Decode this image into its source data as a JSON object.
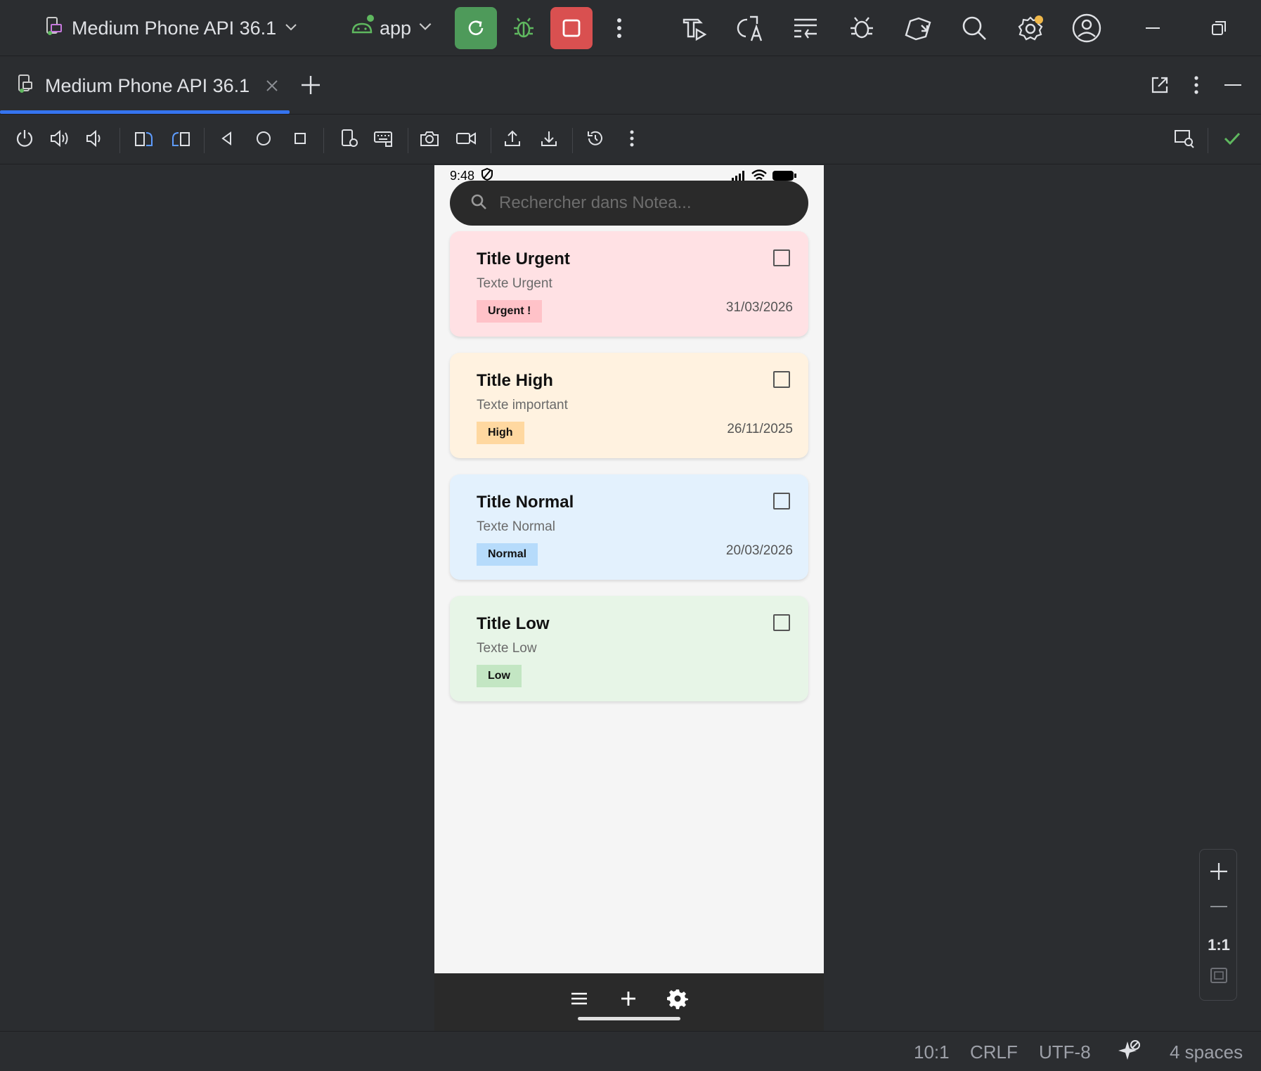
{
  "window": {
    "device_selector": "Medium Phone API 36.1",
    "app_selector": "app"
  },
  "tab": {
    "label": "Medium Phone API 36.1"
  },
  "phone": {
    "status_time": "9:48",
    "search_placeholder": "Rechercher dans Notea...",
    "notes": [
      {
        "title": "Title Urgent",
        "text": "Texte Urgent",
        "badge": "Urgent !",
        "date": "31/03/2026",
        "bg": "#ffe1e4",
        "badge_bg": "#ffc2c8"
      },
      {
        "title": "Title High",
        "text": "Texte important",
        "badge": "High",
        "date": "26/11/2025",
        "bg": "#fff2e0",
        "badge_bg": "#ffd8a0"
      },
      {
        "title": "Title Normal",
        "text": "Texte Normal",
        "badge": "Normal",
        "date": "20/03/2026",
        "bg": "#e3f1fd",
        "badge_bg": "#b6dbfb"
      },
      {
        "title": "Title Low",
        "text": "Texte Low",
        "badge": "Low",
        "date": "",
        "bg": "#e7f5e7",
        "badge_bg": "#c3e6c3"
      }
    ]
  },
  "zoom": {
    "one_to_one": "1:1"
  },
  "statusbar": {
    "position": "10:1",
    "line_endings": "CRLF",
    "encoding": "UTF-8",
    "indent": "4 spaces"
  },
  "colors": {
    "run_button": "#4e9a5a",
    "stop_button": "#d95050",
    "accent": "#3574f0",
    "debug_icon": "#5fb85f"
  },
  "icons": [
    "phone-device-icon",
    "android-icon",
    "rerun-icon",
    "debug-icon",
    "stop-icon",
    "more-icon",
    "build-icon",
    "translate-icon",
    "sync-icon",
    "bug-icon",
    "devices-icon",
    "search-icon",
    "settings-icon",
    "account-icon",
    "minimize-icon",
    "restore-icon"
  ]
}
